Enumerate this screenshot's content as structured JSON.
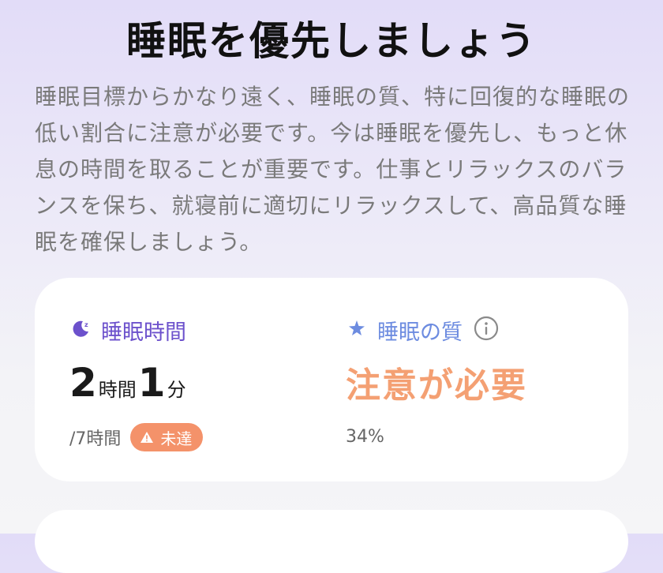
{
  "header": {
    "title": "睡眠を優先しましょう",
    "description": "睡眠目標からかなり遠く、睡眠の質、特に回復的な睡眠の低い割合に注意が必要です。今は睡眠を優先し、もっと休息の時間を取ることが重要です。仕事とリラックスのバランスを保ち、就寝前に適切にリラックスして、高品質な睡眠を確保しましょう。"
  },
  "sleep_duration": {
    "label": "睡眠時間",
    "hours": "2",
    "hours_unit": "時間",
    "minutes": "1",
    "minutes_unit": "分",
    "goal": "/7時間",
    "status_badge": "未達"
  },
  "sleep_quality": {
    "label": "睡眠の質",
    "status": "注意が必要",
    "percent": "34%"
  },
  "colors": {
    "purple": "#6c51cc",
    "blue": "#6d8ce0",
    "orange": "#f4a073",
    "badge": "#f4926a"
  },
  "icons": {
    "sleep_duration": "moon-sleep-icon",
    "sleep_quality": "sparkle-star-icon",
    "info": "info-icon",
    "warning": "warning-triangle-icon"
  }
}
